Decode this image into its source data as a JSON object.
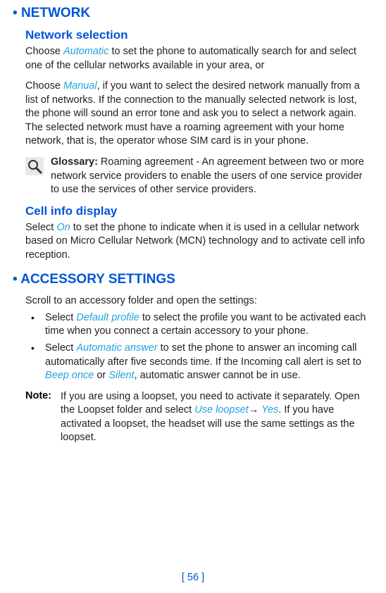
{
  "network": {
    "heading_bullet": "•",
    "heading": "NETWORK",
    "selection_heading": "Network selection",
    "choose_prefix_1": "Choose ",
    "automatic": "Automatic",
    "choose_suffix_1": " to set the phone to automatically search for and select one of the cellular networks available in your area, or",
    "choose_prefix_2": "Choose ",
    "manual": "Manual",
    "choose_suffix_2": ", if you want to select the desired network manually from a list of networks. If the connection to the manually selected network is lost, the phone will sound an error tone and ask you to select a network again. The selected network must have a roaming agreement with your home network, that is, the operator whose SIM card is in your phone.",
    "glossary_label": "Glossary:",
    "glossary_text": " Roaming agreement - An agreement between two or more network service providers to enable the users of one service provider to use the services of other service providers.",
    "cell_heading": "Cell info display",
    "cell_prefix": "Select ",
    "cell_on": "On",
    "cell_suffix": " to set the phone to indicate when it is used in a cellular network based on Micro Cellular Network (MCN) technology and to activate cell info reception."
  },
  "accessory": {
    "heading_bullet": "•",
    "heading": "ACCESSORY SETTINGS",
    "intro": "Scroll to an accessory folder and open the settings:",
    "li1_prefix": "Select ",
    "li1_term": "Default profile",
    "li1_suffix": " to select the profile you want to be activated each time when you connect a certain accessory to your phone.",
    "li2_prefix": "Select ",
    "li2_term": "Automatic answer",
    "li2_mid": " to set the phone to answer an incoming call automatically after five seconds time. If the Incoming call alert is set to ",
    "li2_beep": "Beep once",
    "li2_or": " or ",
    "li2_silent": "Silent",
    "li2_suffix": ", automatic answer cannot be in use.",
    "note_label": "Note:",
    "note_prefix": "If you are using a loopset, you need to activate it separately. Open the Loopset folder and select ",
    "note_use_loopset": "Use loopset",
    "note_arrow": "→",
    "note_yes": " Yes",
    "note_suffix": ". If you have activated a loopset, the headset will use the same settings as the loopset."
  },
  "page": "[ 56 ]"
}
